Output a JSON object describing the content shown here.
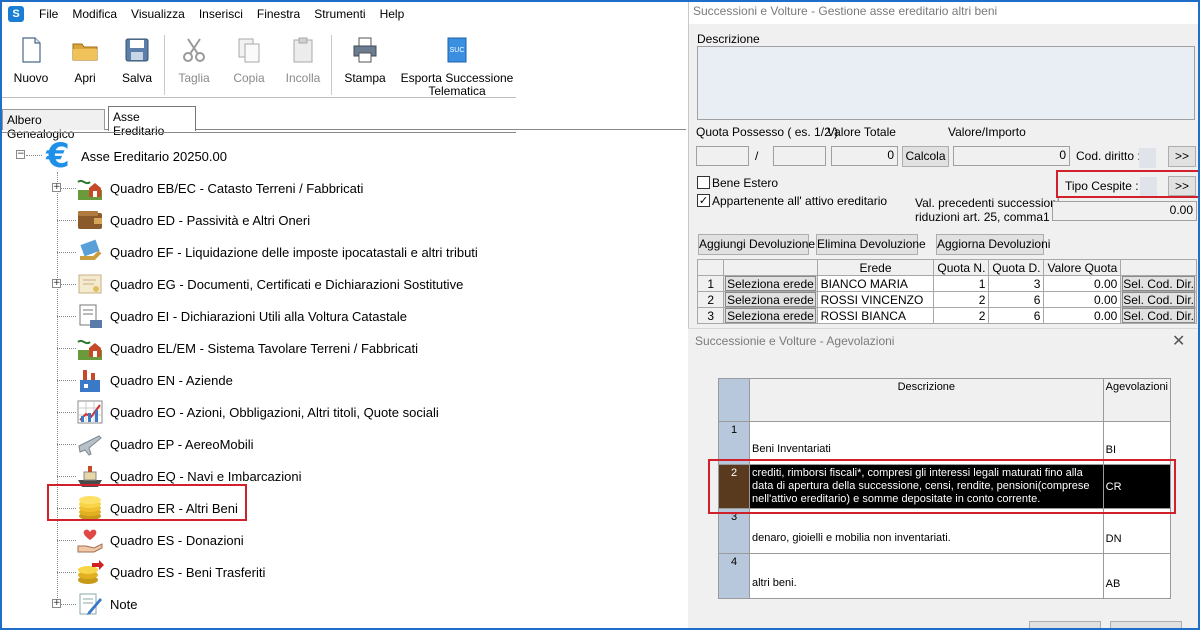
{
  "menubar": {
    "logo": "S",
    "items": [
      "File",
      "Modifica",
      "Visualizza",
      "Inserisci",
      "Finestra",
      "Strumenti",
      "Help"
    ]
  },
  "toolbar": {
    "nuovo": "Nuovo",
    "apri": "Apri",
    "salva": "Salva",
    "taglia": "Taglia",
    "copia": "Copia",
    "incolla": "Incolla",
    "stampa": "Stampa",
    "esporta_line1": "Esporta Successione",
    "esporta_line2": "Telematica",
    "esporta_icon_text": "SUC"
  },
  "tabs": {
    "albero": "Albero Genealogico",
    "asse": "Asse Ereditario"
  },
  "tree": {
    "root_symbol": "€",
    "root_label": "Asse Ereditario 20250.00",
    "items": [
      {
        "label": "Quadro EB/EC - Catasto Terreni / Fabbricati",
        "icon": "land-building-icon",
        "expander": "+"
      },
      {
        "label": "Quadro ED - Passività e Altri Oneri",
        "icon": "wallet-icon",
        "expander": ""
      },
      {
        "label": "Quadro EF - Liquidazione delle imposte ipocatastali e altri tributi",
        "icon": "tax-payment-icon",
        "expander": ""
      },
      {
        "label": "Quadro EG - Documenti, Certificati e Dichiarazioni Sostitutive",
        "icon": "certificate-icon",
        "expander": "+"
      },
      {
        "label": "Quadro EI - Dichiarazioni Utili alla Voltura Catastale",
        "icon": "declaration-icon",
        "expander": ""
      },
      {
        "label": "Quadro EL/EM - Sistema Tavolare Terreni / Fabbricati",
        "icon": "land-building-icon",
        "expander": ""
      },
      {
        "label": "Quadro EN - Aziende",
        "icon": "factory-icon",
        "expander": ""
      },
      {
        "label": "Quadro EO - Azioni, Obbligazioni, Altri titoli, Quote sociali",
        "icon": "stock-chart-icon",
        "expander": ""
      },
      {
        "label": "Quadro EP - AereoMobili",
        "icon": "airplane-icon",
        "expander": ""
      },
      {
        "label": "Quadro EQ - Navi e Imbarcazioni",
        "icon": "ship-icon",
        "expander": ""
      },
      {
        "label": "Quadro ER - Altri Beni",
        "icon": "coins-icon",
        "expander": ""
      },
      {
        "label": "Quadro ES - Donazioni",
        "icon": "heart-hand-icon",
        "expander": ""
      },
      {
        "label": "Quadro ES - Beni Trasferiti",
        "icon": "coins-transfer-icon",
        "expander": ""
      },
      {
        "label": "Note",
        "icon": "note-pencil-icon",
        "expander": "+"
      }
    ]
  },
  "beni_window": {
    "title": "Successioni e Volture - Gestione asse ereditario altri beni",
    "descrizione_label": "Descrizione",
    "quota_possesso_label": "Quota Possesso ( es. 1/2 )",
    "valore_totale_label": "Valore Totale",
    "valore_importo_label": "Valore/Importo",
    "slash": "/",
    "valore_totale_value": "0",
    "calcola": "Calcola",
    "valore_importo_value": "0",
    "cod_diritto_label": "Cod. diritto :",
    "more_button": ">>",
    "bene_estero_label": "Bene Estero",
    "appartenente_label": "Appartenente all' attivo ereditario",
    "appartenente_checked": "✓",
    "tipo_cespite_label": "Tipo Cespite :",
    "val_precedenti_line1": "Val. precedenti successioni,",
    "val_precedenti_line2": "riduzioni art. 25, comma1",
    "val_precedenti_value": "0.00",
    "aggiungi": "Aggiungi Devoluzione",
    "elimina": "Elimina Devoluzione",
    "aggiorna": "Aggiorna Devoluzioni",
    "grid_headers": {
      "erede": "Erede",
      "quota_n": "Quota N.",
      "quota_d": "Quota D.",
      "valore_quota": "Valore Quota"
    },
    "grid_rows": [
      {
        "n": "1",
        "select": "Seleziona erede",
        "erede": "BIANCO MARIA",
        "quota_n": "1",
        "quota_d": "3",
        "valore": "0.00",
        "cod": "Sel. Cod. Dir."
      },
      {
        "n": "2",
        "select": "Seleziona erede",
        "erede": "ROSSI VINCENZO",
        "quota_n": "2",
        "quota_d": "6",
        "valore": "0.00",
        "cod": "Sel. Cod. Dir."
      },
      {
        "n": "3",
        "select": "Seleziona erede",
        "erede": "ROSSI BIANCA",
        "quota_n": "2",
        "quota_d": "6",
        "valore": "0.00",
        "cod": "Sel. Cod. Dir."
      }
    ]
  },
  "agev_window": {
    "title": "Successionie e Volture - Agevolazioni",
    "close": "✕",
    "header_descrizione": "Descrizione",
    "header_agevolazioni": "Agevolazioni",
    "rows": [
      {
        "n": "1",
        "descr": "Beni Inventariati",
        "code": "BI"
      },
      {
        "n": "2",
        "descr": "crediti, rimborsi fiscali*, compresi gli interessi legali maturati fino alla data di apertura della successione, censi, rendite, pensioni(comprese nell'attivo ereditario) e somme depositate in conto corrente.",
        "code": "CR"
      },
      {
        "n": "3",
        "descr": "denaro, gioielli e mobilia non inventariati.",
        "code": "DN"
      },
      {
        "n": "4",
        "descr": "altri beni.",
        "code": "AB"
      }
    ]
  },
  "colors": {
    "accent_blue": "#1e90e8",
    "highlight_red": "#d0202a",
    "selected_row": "#000000",
    "row_number_bg": "#b8c8dc"
  }
}
